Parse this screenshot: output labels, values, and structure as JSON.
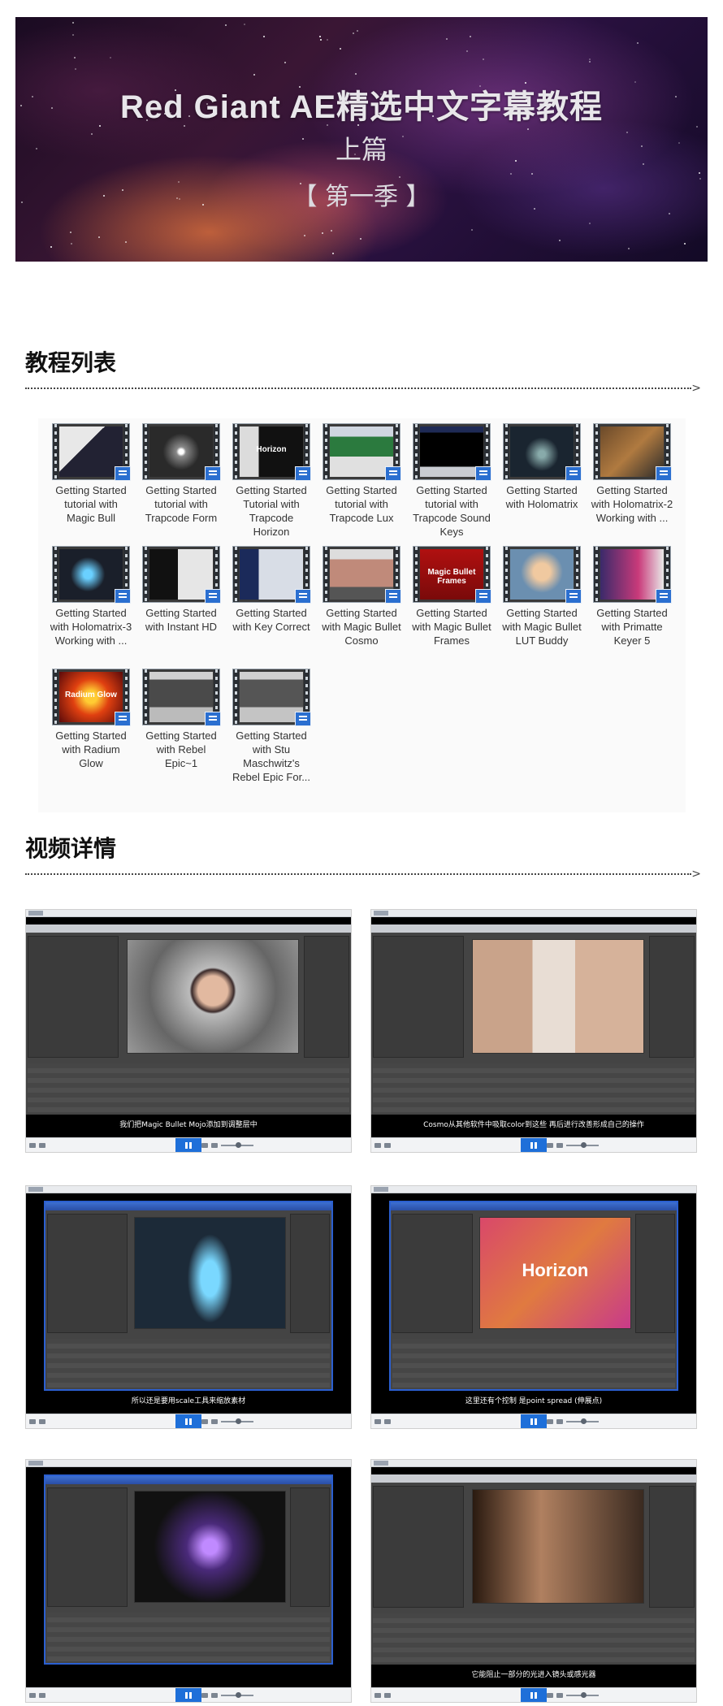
{
  "banner": {
    "title": "Red Giant AE精选中文字幕教程",
    "subtitle": "上篇",
    "season": "【 第一季 】"
  },
  "tutorial_list": {
    "heading": "教程列表",
    "items": [
      {
        "label": "Getting Started tutorial with Magic Bull",
        "icon": "video-thumbnail-icon"
      },
      {
        "label": "Getting Started tutorial with Trapcode Form",
        "icon": "video-thumbnail-icon"
      },
      {
        "label": "Getting Started Tutorial with Trapcode Horizon",
        "icon": "video-thumbnail-icon",
        "screen_text": "Horizon"
      },
      {
        "label": "Getting Started tutorial with Trapcode Lux",
        "icon": "video-thumbnail-icon"
      },
      {
        "label": "Getting Started tutorial with Trapcode Sound Keys",
        "icon": "video-thumbnail-icon"
      },
      {
        "label": "Getting Started with Holomatrix",
        "icon": "video-thumbnail-icon"
      },
      {
        "label": "Getting Started with Holomatrix-2 Working with ...",
        "icon": "video-thumbnail-icon"
      },
      {
        "label": "Getting Started with Holomatrix-3 Working with ...",
        "icon": "video-thumbnail-icon"
      },
      {
        "label": "Getting Started with Instant HD",
        "icon": "video-thumbnail-icon"
      },
      {
        "label": "Getting Started with Key Correct",
        "icon": "video-thumbnail-icon"
      },
      {
        "label": "Getting Started with Magic Bullet Cosmo",
        "icon": "video-thumbnail-icon"
      },
      {
        "label": "Getting Started with Magic Bullet Frames",
        "icon": "video-thumbnail-icon",
        "screen_text": "Magic Bullet Frames"
      },
      {
        "label": "Getting Started with Magic Bullet LUT Buddy",
        "icon": "video-thumbnail-icon"
      },
      {
        "label": "Getting Started with Primatte Keyer 5",
        "icon": "video-thumbnail-icon"
      },
      {
        "label": "Getting Started with Radium Glow",
        "icon": "video-thumbnail-icon",
        "screen_text": "Radium Glow"
      },
      {
        "label": "Getting Started with Rebel Epic~1",
        "icon": "video-thumbnail-icon"
      },
      {
        "label": "Getting Started with Stu Maschwitz's Rebel Epic For...",
        "icon": "video-thumbnail-icon"
      }
    ]
  },
  "video_details": {
    "heading": "视频详情",
    "shots": [
      {
        "subtitle": "我们把Magic Bullet Mojo添加到调整层中"
      },
      {
        "subtitle": "Cosmo从其他软件中吸取color到这些 再后进行改善形成自己的操作"
      },
      {
        "subtitle": "所以还是要用scale工具来缩放素材"
      },
      {
        "subtitle": "这里还有个控制 是point spread (伸展点)",
        "screen_text": "Horizon"
      },
      {
        "subtitle": ""
      },
      {
        "subtitle": "它能阻止一部分的光进入镜头或感光器"
      }
    ]
  },
  "colors": {
    "accent": "#1e6fd9",
    "heading": "#111111",
    "panel_bg": "#fafafa"
  }
}
